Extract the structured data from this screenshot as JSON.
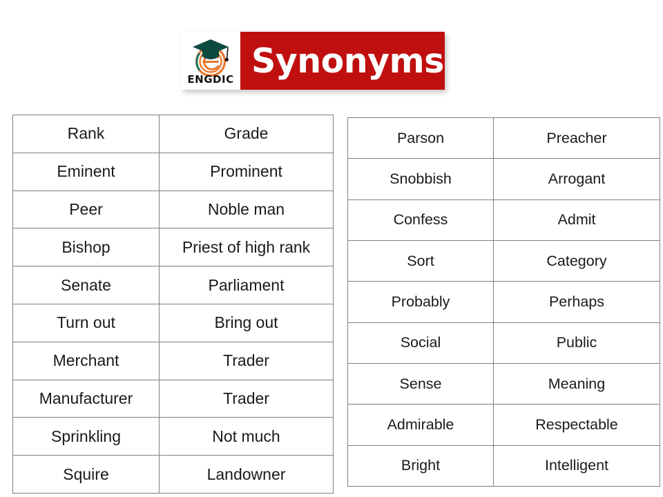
{
  "header": {
    "title": "Synonyms",
    "logo": {
      "name": "engdic-logo",
      "wordmark": "ENGDIC",
      "letter": "e"
    },
    "colors": {
      "banner_background": "#c00f0f",
      "banner_text": "#ffffff",
      "logo_cap": "#0d4a3f",
      "logo_ring": "#e8762c",
      "logo_wordmark": "#111111",
      "page_background": "#ffffff",
      "table_border": "#7f7f7f",
      "table_text": "#1a1a1a"
    }
  },
  "tables": [
    {
      "name": "synonyms-table-left",
      "rows": [
        {
          "term": "Rank",
          "synonym": "Grade"
        },
        {
          "term": "Eminent",
          "synonym": "Prominent"
        },
        {
          "term": "Peer",
          "synonym": "Noble man"
        },
        {
          "term": "Bishop",
          "synonym": "Priest of high rank"
        },
        {
          "term": "Senate",
          "synonym": "Parliament"
        },
        {
          "term": "Turn out",
          "synonym": "Bring out"
        },
        {
          "term": "Merchant",
          "synonym": "Trader"
        },
        {
          "term": "Manufacturer",
          "synonym": "Trader"
        },
        {
          "term": "Sprinkling",
          "synonym": "Not much"
        },
        {
          "term": "Squire",
          "synonym": "Landowner"
        }
      ]
    },
    {
      "name": "synonyms-table-right",
      "rows": [
        {
          "term": "Parson",
          "synonym": "Preacher"
        },
        {
          "term": "Snobbish",
          "synonym": "Arrogant"
        },
        {
          "term": "Confess",
          "synonym": "Admit"
        },
        {
          "term": "Sort",
          "synonym": "Category"
        },
        {
          "term": "Probably",
          "synonym": "Perhaps"
        },
        {
          "term": "Social",
          "synonym": "Public"
        },
        {
          "term": "Sense",
          "synonym": "Meaning"
        },
        {
          "term": "Admirable",
          "synonym": "Respectable"
        },
        {
          "term": "Bright",
          "synonym": "Intelligent"
        }
      ]
    }
  ]
}
